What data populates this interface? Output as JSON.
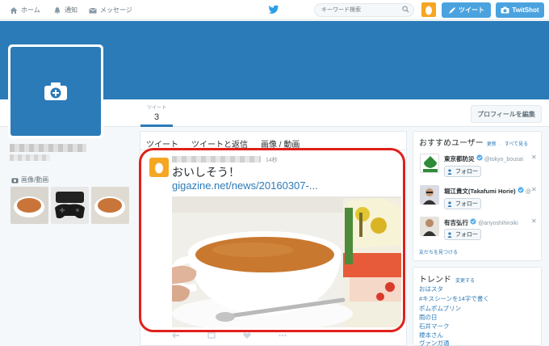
{
  "nav": {
    "home": "ホーム",
    "notifications": "通知",
    "messages": "メッセージ",
    "search_placeholder": "キーワード検索",
    "tweet_button": "ツイート",
    "twitshot_button": "TwitShot"
  },
  "profile": {
    "stat_label": "ツイート",
    "stat_value": "3",
    "edit_button": "プロフィールを編集",
    "media_label": "画像/動画"
  },
  "timeline": {
    "tabs": [
      "ツイート",
      "ツイートと返信",
      "画像 / 動画"
    ],
    "tweet": {
      "time": "14秒",
      "text": "おいしそう！",
      "link": "gigazine.net/news/20160307-..."
    }
  },
  "suggestions": {
    "title": "おすすめユーザー",
    "refresh": "更新",
    "see_all": "すべて見る",
    "users": [
      {
        "name": "東京都防災",
        "handle": "@tokyo_bousai",
        "follow": "フォロー"
      },
      {
        "name": "堀江貴文(Takafumi Horie)",
        "handle": "@",
        "follow": "フォロー"
      },
      {
        "name": "有吉弘行",
        "handle": "@ariyoshihiroiki",
        "follow": "フォロー"
      }
    ],
    "find_friends": "友だちを見つける"
  },
  "trends": {
    "title": "トレンド",
    "change": "変更する",
    "items": [
      "おはスタ",
      "#キスシーンを14字で書く",
      "ポムポムプリン",
      "雨の日",
      "石井マーク",
      "榎本さん",
      "ヴァンガ通"
    ]
  },
  "colors": {
    "brand": "#2b7bb9",
    "button": "#4aa3df",
    "highlight": "#e0201b",
    "avatar": "#f5a623"
  }
}
